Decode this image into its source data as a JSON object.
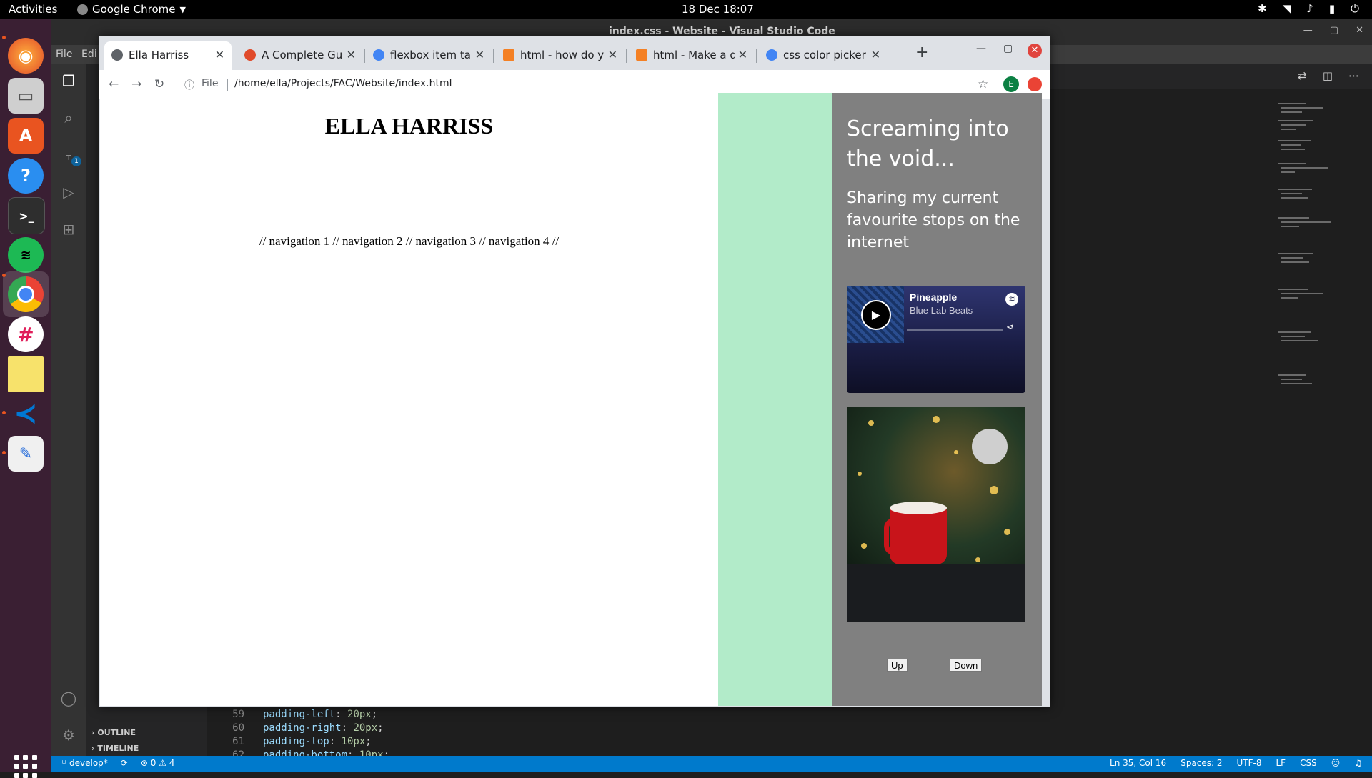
{
  "topbar": {
    "activities": "Activities",
    "app_name": "Google Chrome",
    "clock": "18 Dec  18:07"
  },
  "dock": {
    "apps": [
      "firefox-icon",
      "files-icon",
      "software-icon",
      "help-icon",
      "terminal-icon",
      "spotify-icon",
      "chrome-icon",
      "slack-icon",
      "notes-icon",
      "vscode-icon",
      "text-editor-icon"
    ],
    "colors": {
      "firefox": "#ff7139",
      "files": "#a0a0a0",
      "software": "#e95420",
      "help": "#2a8ef0",
      "terminal": "#2e2e2e",
      "spotify": "#1db954",
      "chrome": "#4285f4",
      "slack": "#e01e5a",
      "notes": "#f7e26b",
      "vscode": "#0078d4",
      "editor": "#f0f0f0"
    }
  },
  "vscode": {
    "title": "index.css - Website - Visual Studio Code",
    "menu": [
      "File",
      "Edi"
    ],
    "sections": [
      "OUTLINE",
      "TIMELINE"
    ],
    "scm_badge": "1",
    "code": [
      {
        "ln": "59",
        "prop": "padding-left",
        "val": "20px"
      },
      {
        "ln": "60",
        "prop": "padding-right",
        "val": "20px"
      },
      {
        "ln": "61",
        "prop": "padding-top",
        "val": "10px"
      },
      {
        "ln": "62",
        "prop": "padding-bottom",
        "val": "10px"
      }
    ],
    "status": {
      "branch": "develop*",
      "problems": "0",
      "warnings": "4",
      "position": "Ln 35, Col 16",
      "spaces": "Spaces: 2",
      "encoding": "UTF-8",
      "eol": "LF",
      "language": "CSS"
    },
    "accent": "#007acc"
  },
  "chrome": {
    "tabs": [
      {
        "label": "Ella Harriss",
        "fav_color": "#5f6368"
      },
      {
        "label": "A Complete Guide",
        "fav_color": "#e04a2a"
      },
      {
        "label": "flexbox item take",
        "fav_color": "#4285f4"
      },
      {
        "label": "html - how do you",
        "fav_color": "#f48024"
      },
      {
        "label": "html - Make a div f",
        "fav_color": "#f48024"
      },
      {
        "label": "css color picker - C",
        "fav_color": "#4285f4"
      }
    ],
    "new_tab": "+",
    "url_scheme": "File",
    "url": "/home/ella/Projects/FAC/Website/index.html",
    "profile_initial": "E"
  },
  "page": {
    "title": "ELLA HARRISS",
    "nav": "// navigation 1 // navigation 2 // navigation 3 // navigation 4 //",
    "side_heading": "Screaming into the void...",
    "side_subheading": "Sharing my current favourite stops on the internet",
    "spotify": {
      "track": "Pineapple",
      "artist": "Blue Lab Beats"
    },
    "buttons": {
      "up": "Up",
      "down": "Down"
    },
    "colors": {
      "green": "#b2ebc9",
      "side": "#808080"
    }
  }
}
